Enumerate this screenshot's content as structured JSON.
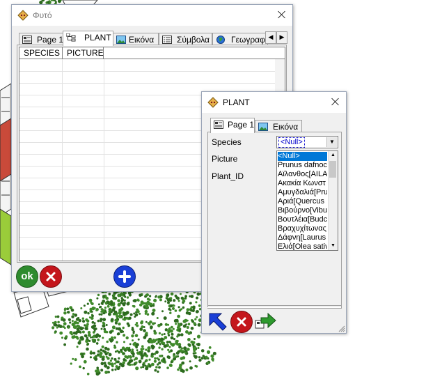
{
  "main_window": {
    "title": "Φυτό",
    "tabs": [
      {
        "label": "Page 1",
        "icon": "page-icon"
      },
      {
        "label": "PLANT",
        "icon": "tree-structure-icon"
      },
      {
        "label": "Εικόνα",
        "icon": "picture-icon"
      },
      {
        "label": "Σύμβολα",
        "icon": "list-icon"
      },
      {
        "label": "Γεωγραφ",
        "icon": "globe-icon"
      }
    ],
    "active_tab": "PLANT",
    "grid_columns": [
      "SPECIES",
      "PICTURE"
    ],
    "buttons": {
      "ok_label": "ok"
    }
  },
  "plant_dialog": {
    "title": "PLANT",
    "tabs": [
      {
        "label": "Page 1",
        "icon": "page-icon"
      },
      {
        "label": "Εικόνα",
        "icon": "picture-icon"
      }
    ],
    "active_tab": "Page 1",
    "fields": {
      "species_label": "Species",
      "picture_label": "Picture",
      "plant_id_label": "Plant_ID"
    },
    "species_value": "<Null>",
    "species_options": [
      "<Null>",
      "Prunus dafnoc",
      "Αϊλανθος[AILA",
      "Ακακία Κωνστ",
      "Αμυγδαλιά[Pru",
      "Αριά[Quercus",
      "Βιβούρνο[Vibu",
      "Βουτλέια[Budc",
      "Βραχυχίτωνας",
      "Δάφνη[Laurus",
      "Ελιά[Olea sativ"
    ],
    "selected_option_index": 0
  },
  "colors": {
    "highlight": "#0078d7",
    "ok_button": "#2e8b2e",
    "cancel_button": "#c4161c",
    "add_button": "#1a3fd6"
  }
}
